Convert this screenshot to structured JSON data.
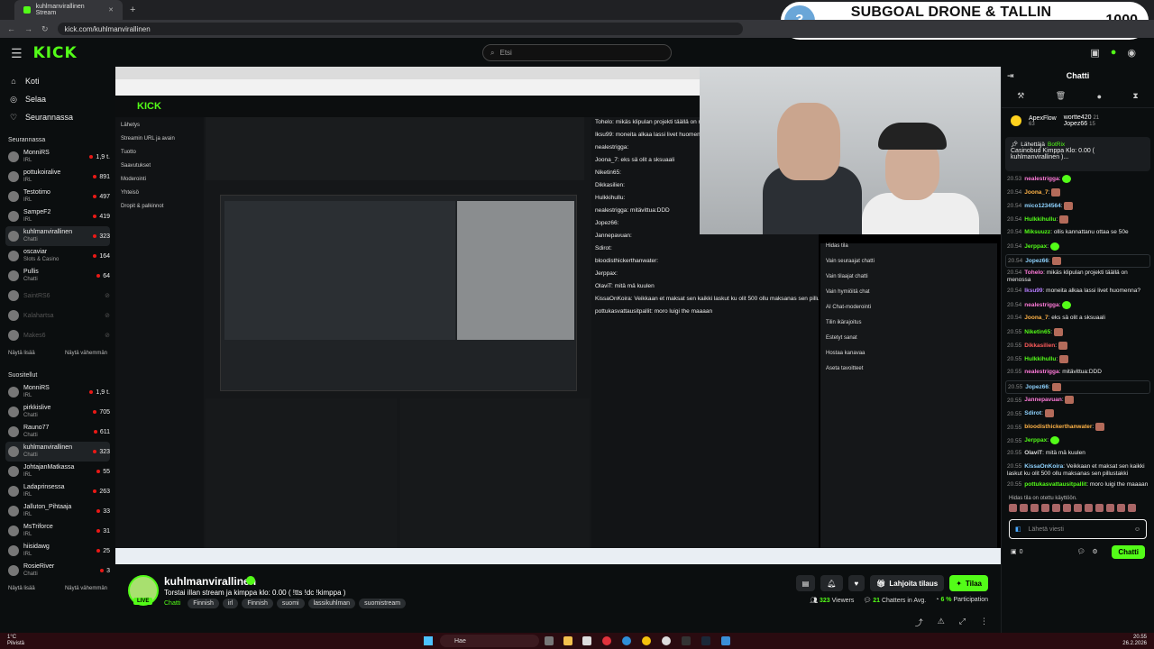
{
  "browser": {
    "tab_title": "kuhlmanvirallinen Stream",
    "url": "kick.com/kuhlmanvirallinen"
  },
  "subgoal": {
    "number": "3",
    "label": "SUBGOAL DRONE & TALLIN MATKA",
    "value": "1000"
  },
  "kick": {
    "logo": "KICK",
    "search_placeholder": "Etsi"
  },
  "sidebar": {
    "nav": [
      {
        "label": "Koti",
        "icon": "home-icon"
      },
      {
        "label": "Selaa",
        "icon": "compass-icon"
      },
      {
        "label": "Seurannassa",
        "icon": "heart-icon"
      }
    ],
    "following_title": "Seurannassa",
    "following": [
      {
        "name": "MonniRS",
        "sub": "IRL",
        "viewers": "1,9 t."
      },
      {
        "name": "pottukoiralive",
        "sub": "IRL",
        "viewers": "891"
      },
      {
        "name": "Testotimo",
        "sub": "IRL",
        "viewers": "497"
      },
      {
        "name": "SampeF2",
        "sub": "IRL",
        "viewers": "419"
      },
      {
        "name": "kuhlmanvirallinen",
        "sub": "Chatti",
        "viewers": "323"
      },
      {
        "name": "oscaviar",
        "sub": "Slots & Casino",
        "viewers": "164"
      },
      {
        "name": "Pullis",
        "sub": "Chatti",
        "viewers": "64"
      },
      {
        "name": "SaintRS6",
        "sub": "",
        "viewers": ""
      },
      {
        "name": "Kalahartsa",
        "sub": "",
        "viewers": ""
      },
      {
        "name": "Makes6",
        "sub": "",
        "viewers": ""
      }
    ],
    "show_more": "Näytä lisää",
    "show_less": "Näytä vähemmän",
    "recommended_title": "Suositellut",
    "recommended": [
      {
        "name": "MonniRS",
        "sub": "IRL",
        "viewers": "1,9 t."
      },
      {
        "name": "pirkkislive",
        "sub": "Chatti",
        "viewers": "705"
      },
      {
        "name": "Rauno77",
        "sub": "Chatti",
        "viewers": "611"
      },
      {
        "name": "kuhlmanvirallinen",
        "sub": "Chatti",
        "viewers": "323"
      },
      {
        "name": "JohtajanMatkassa",
        "sub": "IRL",
        "viewers": "55"
      },
      {
        "name": "Ladaprinsessa",
        "sub": "IRL",
        "viewers": "263"
      },
      {
        "name": "Jalluton_Pihtaaja",
        "sub": "IRL",
        "viewers": "33"
      },
      {
        "name": "MsTriforce",
        "sub": "IRL",
        "viewers": "31"
      },
      {
        "name": "hiisidawg",
        "sub": "IRL",
        "viewers": "25"
      },
      {
        "name": "RosieRiver",
        "sub": "Chatti",
        "viewers": "3"
      }
    ]
  },
  "stream_info": {
    "channel": "kuhlmanvirallinen",
    "live": "LIVE",
    "title": "Torstai illan stream ja kimppa klo: 0.00 ( !tts !dc !kimppa )",
    "category": "Chatti",
    "tags": [
      "Finnish",
      "irl",
      "Finnish",
      "suomi",
      "lassikuhlman",
      "suomistream"
    ],
    "gift_label": "Lahjoita tilaus",
    "subscribe_label": "Tilaa",
    "viewers": "323",
    "viewers_label": "Viewers",
    "chatters": "21",
    "chatters_label": "Chatters in Avg.",
    "participation": "6 %",
    "participation_label": "Participation"
  },
  "screen_dashboard": {
    "nav": [
      "Lähetys",
      "Streamin URL ja avain",
      "Tuotto",
      "Saavutukset",
      "Moderointi",
      "Yhteisö",
      "Dropit & palkinnot"
    ],
    "chat_lines": [
      "Tohelo: mikäs klipulan projekti täällä on menossa",
      "Iksu99: moneita alkaa lassi livet huomenna?",
      "nealestrigga:",
      "Joona_7: eks sä olit a sksuaali",
      "Niketin65:",
      "Dikkasilien:",
      "Hulkkihullu:",
      "nealestrigga: mitävittua:DDD",
      "Jopez66:",
      "Jannepavuan:",
      "Sdirot:",
      "bloodisthickerthanwater:",
      "Jerppax:",
      "OlaviT: mitä mä kuulen",
      "KissaOnKoira: Veikkaan et maksat sen kaikki laskut ku olit 500 ollu maksanas sen pillustakki",
      "pottukasvattausitpallit: moro luigi the maaaan"
    ],
    "channel_actions": [
      "Hidas tila",
      "Vain seuraajat chatti",
      "Vain tilaajat chatti",
      "Vain hymiöitä chat",
      "AI Chat-moderointi",
      "Tilin ikärajoitus",
      "Estetyt sanat",
      "Hostaa kanavaa",
      "Aseta tavoitteet"
    ]
  },
  "chat": {
    "title": "Chatti",
    "gifters": [
      {
        "name": "ApexFlow",
        "count": "63"
      },
      {
        "name": "wortte420",
        "count": "21"
      },
      {
        "name": "Jopez66",
        "count": "15"
      }
    ],
    "pinned_sender": "Lähettäjä",
    "pinned_bot": "BotRix",
    "pinned_text": "Casinobud Kimppa Klo: 0.00 ( kuhlmanvirallinen )...",
    "messages": [
      {
        "ts": "20.53",
        "user": "nealestrigga",
        "color": "#ff7ad9",
        "text": "",
        "emote": "g"
      },
      {
        "ts": "20.54",
        "user": "Joona_7",
        "color": "#ffb347",
        "text": "",
        "emote": "e"
      },
      {
        "ts": "20.54",
        "user": "mico1234564",
        "color": "#8fd3ff",
        "text": "",
        "emote": "e"
      },
      {
        "ts": "20.54",
        "user": "Hulkkihullu",
        "color": "#53fc18",
        "text": "",
        "emote": "e"
      },
      {
        "ts": "20.54",
        "user": "Miksuuzz",
        "color": "#53fc18",
        "text": "ollis kannattanu ottaa se 50e",
        "emote": ""
      },
      {
        "ts": "20.54",
        "user": "Jerppax",
        "color": "#53fc18",
        "text": "",
        "emote": "g"
      },
      {
        "ts": "20.54",
        "user": "Jopez66",
        "color": "#8fd3ff",
        "text": "",
        "emote": "e"
      },
      {
        "ts": "20.54",
        "user": "Tohelo",
        "color": "#ff7ad9",
        "text": "mikäs klipulan projekti täällä on menossa",
        "emote": ""
      },
      {
        "ts": "20.54",
        "user": "Iksu99",
        "color": "#b57dff",
        "text": "moneita alkaa lassi livet huomenna?",
        "emote": ""
      },
      {
        "ts": "20.54",
        "user": "nealestrigga",
        "color": "#ff7ad9",
        "text": "",
        "emote": "g"
      },
      {
        "ts": "20.54",
        "user": "Joona_7",
        "color": "#ffb347",
        "text": "eks sä olit a sksuaali",
        "emote": ""
      },
      {
        "ts": "20.55",
        "user": "Niketin65",
        "color": "#53fc18",
        "text": "",
        "emote": "e"
      },
      {
        "ts": "20.55",
        "user": "Dikkasilien",
        "color": "#ff5c5c",
        "text": "",
        "emote": "e"
      },
      {
        "ts": "20.55",
        "user": "Hulkkihullu",
        "color": "#53fc18",
        "text": "",
        "emote": "e"
      },
      {
        "ts": "20.55",
        "user": "nealestrigga",
        "color": "#ff7ad9",
        "text": "mitävittua:DDD",
        "emote": ""
      },
      {
        "ts": "20.55",
        "user": "Jopez66",
        "color": "#8fd3ff",
        "text": "",
        "emote": "e"
      },
      {
        "ts": "20.55",
        "user": "Jannepavuan",
        "color": "#ff7ad9",
        "text": "",
        "emote": "e"
      },
      {
        "ts": "20.55",
        "user": "Sdirot",
        "color": "#8fd3ff",
        "text": "",
        "emote": "e"
      },
      {
        "ts": "20.55",
        "user": "bloodisthickerthanwater",
        "color": "#ffb347",
        "text": "",
        "emote": "e"
      },
      {
        "ts": "20.55",
        "user": "Jerppax",
        "color": "#53fc18",
        "text": "",
        "emote": "g"
      },
      {
        "ts": "20.55",
        "user": "OlaviT",
        "color": "#dddddd",
        "text": "mitä mä kuulen",
        "emote": ""
      },
      {
        "ts": "20.55",
        "user": "KissaOnKoira",
        "color": "#8fd3ff",
        "text": "Veikkaan et maksat sen kaikki laskut ku olit 500 ollu maksanas sen pillustakki",
        "emote": ""
      },
      {
        "ts": "20.55",
        "user": "pottukasvattausitpallit",
        "color": "#53fc18",
        "text": "moro luigi the maaaan",
        "emote": ""
      }
    ],
    "slow_mode_note": "Hidas tila on otettu käyttöön.",
    "input_placeholder": "Lähetä viesti",
    "points": "0",
    "send_label": "Chatti"
  },
  "taskbar": {
    "weather_temp": "1°C",
    "weather_text": "Pilvistä",
    "search": "Hae",
    "time": "20.55",
    "date": "26.2.2026"
  }
}
